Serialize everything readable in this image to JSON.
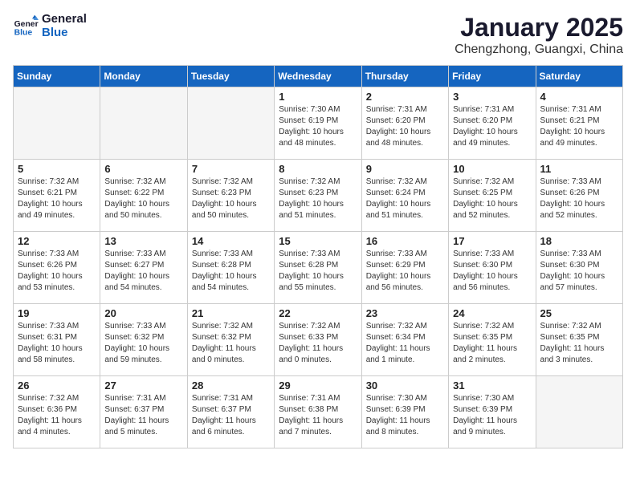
{
  "header": {
    "logo_line1": "General",
    "logo_line2": "Blue",
    "month": "January 2025",
    "location": "Chengzhong, Guangxi, China"
  },
  "weekdays": [
    "Sunday",
    "Monday",
    "Tuesday",
    "Wednesday",
    "Thursday",
    "Friday",
    "Saturday"
  ],
  "weeks": [
    [
      {
        "day": "",
        "info": ""
      },
      {
        "day": "",
        "info": ""
      },
      {
        "day": "",
        "info": ""
      },
      {
        "day": "1",
        "info": "Sunrise: 7:30 AM\nSunset: 6:19 PM\nDaylight: 10 hours\nand 48 minutes."
      },
      {
        "day": "2",
        "info": "Sunrise: 7:31 AM\nSunset: 6:20 PM\nDaylight: 10 hours\nand 48 minutes."
      },
      {
        "day": "3",
        "info": "Sunrise: 7:31 AM\nSunset: 6:20 PM\nDaylight: 10 hours\nand 49 minutes."
      },
      {
        "day": "4",
        "info": "Sunrise: 7:31 AM\nSunset: 6:21 PM\nDaylight: 10 hours\nand 49 minutes."
      }
    ],
    [
      {
        "day": "5",
        "info": "Sunrise: 7:32 AM\nSunset: 6:21 PM\nDaylight: 10 hours\nand 49 minutes."
      },
      {
        "day": "6",
        "info": "Sunrise: 7:32 AM\nSunset: 6:22 PM\nDaylight: 10 hours\nand 50 minutes."
      },
      {
        "day": "7",
        "info": "Sunrise: 7:32 AM\nSunset: 6:23 PM\nDaylight: 10 hours\nand 50 minutes."
      },
      {
        "day": "8",
        "info": "Sunrise: 7:32 AM\nSunset: 6:23 PM\nDaylight: 10 hours\nand 51 minutes."
      },
      {
        "day": "9",
        "info": "Sunrise: 7:32 AM\nSunset: 6:24 PM\nDaylight: 10 hours\nand 51 minutes."
      },
      {
        "day": "10",
        "info": "Sunrise: 7:32 AM\nSunset: 6:25 PM\nDaylight: 10 hours\nand 52 minutes."
      },
      {
        "day": "11",
        "info": "Sunrise: 7:33 AM\nSunset: 6:26 PM\nDaylight: 10 hours\nand 52 minutes."
      }
    ],
    [
      {
        "day": "12",
        "info": "Sunrise: 7:33 AM\nSunset: 6:26 PM\nDaylight: 10 hours\nand 53 minutes."
      },
      {
        "day": "13",
        "info": "Sunrise: 7:33 AM\nSunset: 6:27 PM\nDaylight: 10 hours\nand 54 minutes."
      },
      {
        "day": "14",
        "info": "Sunrise: 7:33 AM\nSunset: 6:28 PM\nDaylight: 10 hours\nand 54 minutes."
      },
      {
        "day": "15",
        "info": "Sunrise: 7:33 AM\nSunset: 6:28 PM\nDaylight: 10 hours\nand 55 minutes."
      },
      {
        "day": "16",
        "info": "Sunrise: 7:33 AM\nSunset: 6:29 PM\nDaylight: 10 hours\nand 56 minutes."
      },
      {
        "day": "17",
        "info": "Sunrise: 7:33 AM\nSunset: 6:30 PM\nDaylight: 10 hours\nand 56 minutes."
      },
      {
        "day": "18",
        "info": "Sunrise: 7:33 AM\nSunset: 6:30 PM\nDaylight: 10 hours\nand 57 minutes."
      }
    ],
    [
      {
        "day": "19",
        "info": "Sunrise: 7:33 AM\nSunset: 6:31 PM\nDaylight: 10 hours\nand 58 minutes."
      },
      {
        "day": "20",
        "info": "Sunrise: 7:33 AM\nSunset: 6:32 PM\nDaylight: 10 hours\nand 59 minutes."
      },
      {
        "day": "21",
        "info": "Sunrise: 7:32 AM\nSunset: 6:32 PM\nDaylight: 11 hours\nand 0 minutes."
      },
      {
        "day": "22",
        "info": "Sunrise: 7:32 AM\nSunset: 6:33 PM\nDaylight: 11 hours\nand 0 minutes."
      },
      {
        "day": "23",
        "info": "Sunrise: 7:32 AM\nSunset: 6:34 PM\nDaylight: 11 hours\nand 1 minute."
      },
      {
        "day": "24",
        "info": "Sunrise: 7:32 AM\nSunset: 6:35 PM\nDaylight: 11 hours\nand 2 minutes."
      },
      {
        "day": "25",
        "info": "Sunrise: 7:32 AM\nSunset: 6:35 PM\nDaylight: 11 hours\nand 3 minutes."
      }
    ],
    [
      {
        "day": "26",
        "info": "Sunrise: 7:32 AM\nSunset: 6:36 PM\nDaylight: 11 hours\nand 4 minutes."
      },
      {
        "day": "27",
        "info": "Sunrise: 7:31 AM\nSunset: 6:37 PM\nDaylight: 11 hours\nand 5 minutes."
      },
      {
        "day": "28",
        "info": "Sunrise: 7:31 AM\nSunset: 6:37 PM\nDaylight: 11 hours\nand 6 minutes."
      },
      {
        "day": "29",
        "info": "Sunrise: 7:31 AM\nSunset: 6:38 PM\nDaylight: 11 hours\nand 7 minutes."
      },
      {
        "day": "30",
        "info": "Sunrise: 7:30 AM\nSunset: 6:39 PM\nDaylight: 11 hours\nand 8 minutes."
      },
      {
        "day": "31",
        "info": "Sunrise: 7:30 AM\nSunset: 6:39 PM\nDaylight: 11 hours\nand 9 minutes."
      },
      {
        "day": "",
        "info": ""
      }
    ]
  ]
}
